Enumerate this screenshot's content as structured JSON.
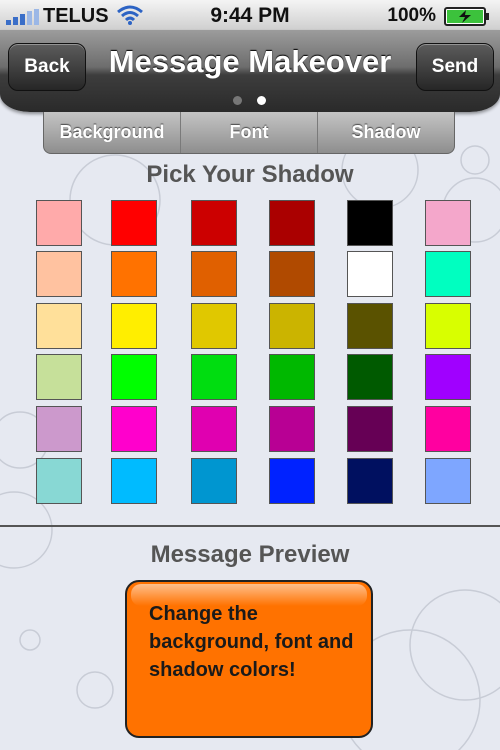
{
  "status_bar": {
    "carrier": "TELUS",
    "time": "9:44 PM",
    "battery": "100%"
  },
  "nav": {
    "back_label": "Back",
    "title": "Message Makeover",
    "send_label": "Send",
    "page_count": 2,
    "active_page": 2
  },
  "tabs": [
    {
      "label": "Background"
    },
    {
      "label": "Font"
    },
    {
      "label": "Shadow"
    }
  ],
  "picker": {
    "title": "Pick Your Shadow",
    "colors": [
      [
        "#ffaaaa",
        "#ff0000",
        "#cc0000",
        "#aa0000",
        "#000000",
        "#f4a7cb"
      ],
      [
        "#ffc2a0",
        "#ff7200",
        "#e06000",
        "#b04a00",
        "#ffffff",
        "#00ffc0"
      ],
      [
        "#ffe09a",
        "#ffee00",
        "#e0c800",
        "#cbb400",
        "#5a5200",
        "#d8ff00"
      ],
      [
        "#c6e09a",
        "#00ff00",
        "#00dd10",
        "#00b800",
        "#005a00",
        "#a000ff"
      ],
      [
        "#cc99cc",
        "#ff00cc",
        "#e000b0",
        "#b80094",
        "#660055",
        "#ff00a0"
      ],
      [
        "#88d8d4",
        "#00bbff",
        "#0096d0",
        "#0022ff",
        "#001060",
        "#7ea6ff"
      ]
    ]
  },
  "preview": {
    "title": "Message Preview",
    "message": "Change the background, font and shadow colors!",
    "bubble_color": "#ff7200"
  }
}
